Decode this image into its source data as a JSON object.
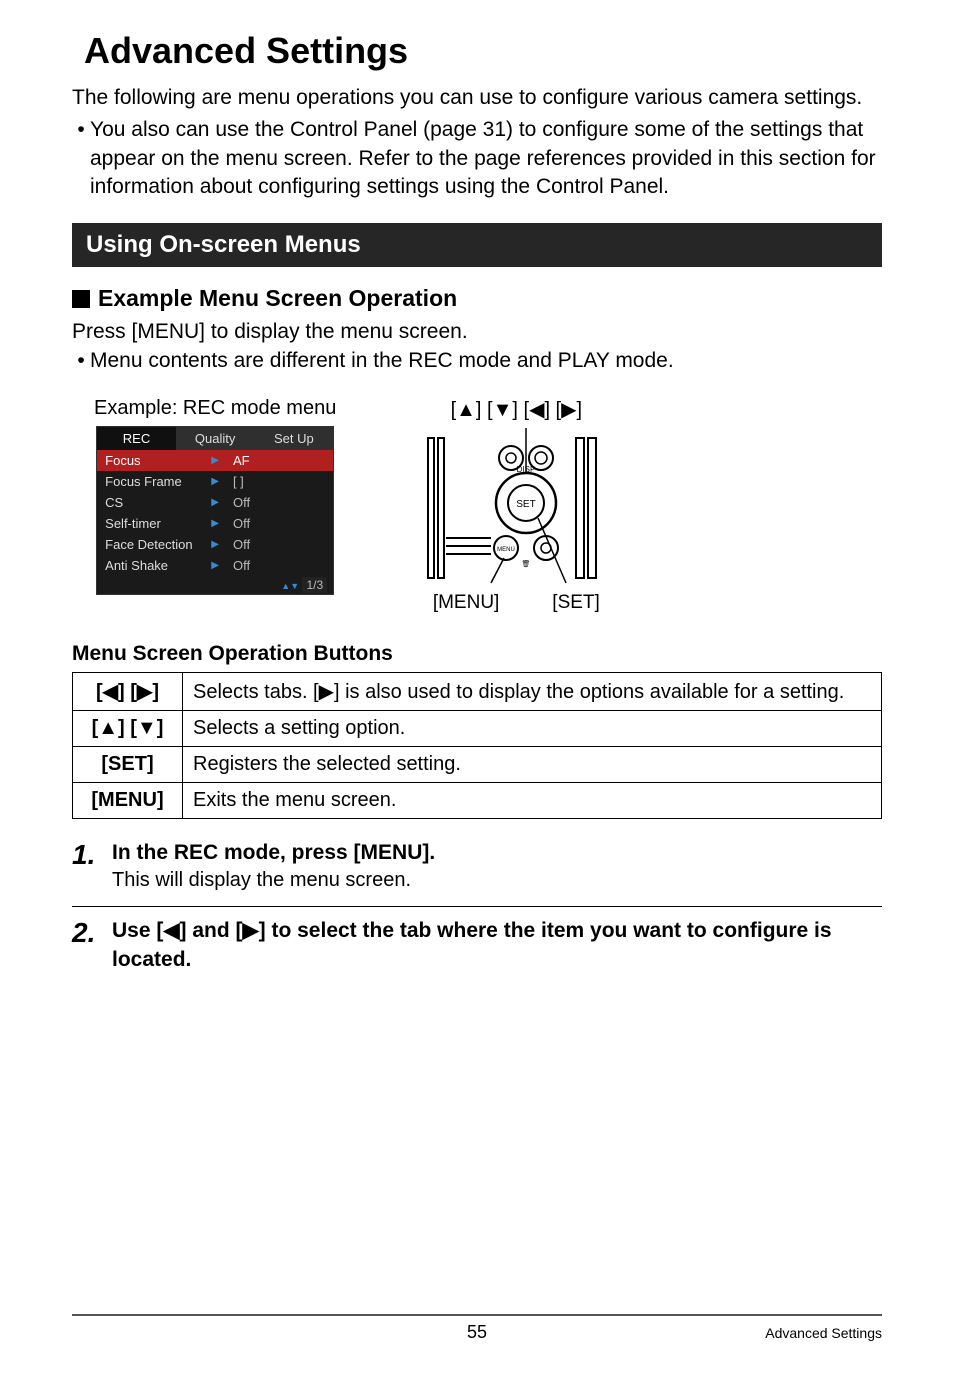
{
  "page": {
    "title": "Advanced Settings",
    "intro": "The following are menu operations you can use to configure various camera settings.",
    "bullet1": "You also can use the Control Panel (page 31) to configure some of the settings that appear on the menu screen. Refer to the page references provided in this section for information about configuring settings using the Control Panel.",
    "section_bar": "Using On-screen Menus",
    "sub_title": "Example Menu Screen Operation",
    "press_menu": "Press [MENU] to display the menu screen.",
    "bullet2": "Menu contents are different in the REC mode and PLAY mode.",
    "example_caption": "Example: REC mode menu",
    "arrows_label": "[▲] [▼] [◀] [▶]",
    "menu_label": "[MENU]",
    "set_label": "[SET]",
    "buttons_heading": "Menu Screen Operation Buttons",
    "footer_page": "55",
    "footer_section": "Advanced Settings"
  },
  "rec_menu": {
    "tabs": [
      "REC",
      "Quality",
      "Set Up"
    ],
    "items": [
      {
        "label": "Focus",
        "value": "AF",
        "selected": true
      },
      {
        "label": "Focus Frame",
        "value": "[ ]",
        "selected": false
      },
      {
        "label": "CS",
        "value": "Off",
        "selected": false
      },
      {
        "label": "Self-timer",
        "value": "Off",
        "selected": false
      },
      {
        "label": "Face Detection",
        "value": "Off",
        "selected": false
      },
      {
        "label": "Anti Shake",
        "value": "Off",
        "selected": false
      }
    ],
    "page_indicator": "1/3"
  },
  "buttons_table": {
    "rows": [
      {
        "key": "[◀] [▶]",
        "desc": "Selects tabs. [▶] is also used to display the options available for a setting."
      },
      {
        "key": "[▲] [▼]",
        "desc": "Selects a setting option."
      },
      {
        "key": "[SET]",
        "desc": "Registers the selected setting."
      },
      {
        "key": "[MENU]",
        "desc": "Exits the menu screen."
      }
    ]
  },
  "steps": {
    "s1": {
      "num": "1.",
      "instr": "In the REC mode, press [MENU].",
      "sub": "This will display the menu screen."
    },
    "s2": {
      "num": "2.",
      "instr": "Use [◀] and [▶] to select the tab where the item you want to configure is located."
    }
  }
}
